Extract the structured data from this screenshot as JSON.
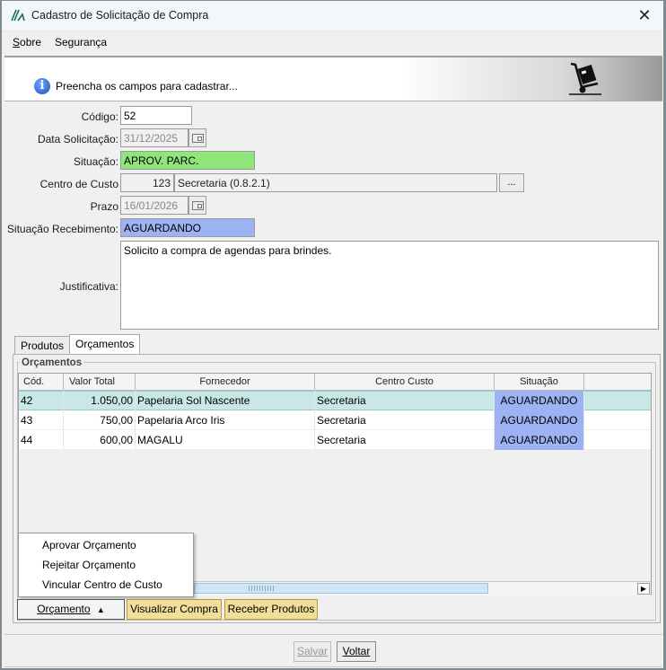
{
  "window": {
    "title": "Cadastro de Solicitação de Compra",
    "close_glyph": "✕"
  },
  "menu": {
    "items": [
      {
        "prefix": "S",
        "rest": "obre"
      },
      {
        "label": "Segurança"
      }
    ]
  },
  "banner": {
    "text": "Preencha os campos para cadastrar...",
    "icon": "info-icon",
    "image": "hand-truck-icon"
  },
  "form": {
    "codigo": {
      "label": "Código:",
      "value": "52"
    },
    "data_solicitacao": {
      "label": "Data Solicitação:",
      "value": "31/12/2025"
    },
    "situacao": {
      "label": "Situação:",
      "value": "APROV. PARC.",
      "color": "#8fe57a"
    },
    "centro_custo": {
      "label": "Centro de Custo",
      "code": "123",
      "name": "Secretaria (0.8.2.1)",
      "button": "..."
    },
    "prazo": {
      "label": "Prazo",
      "value": "16/01/2026"
    },
    "situacao_recebimento": {
      "label": "Situação Recebimento:",
      "value": "AGUARDANDO",
      "color": "#9db2f2"
    },
    "justificativa": {
      "label": "Justificativa:",
      "value": "Solicito a compra de agendas para brindes."
    }
  },
  "tabs": [
    {
      "label": "Produtos",
      "active": false
    },
    {
      "label": "Orçamentos",
      "active": true
    }
  ],
  "orcamentos": {
    "group_title": "Orçamentos",
    "columns": [
      "Cód.",
      "Valor Total",
      "Fornecedor",
      "Centro Custo",
      "Situação"
    ],
    "rows": [
      {
        "cod": "42",
        "valor": "1.050,00",
        "fornecedor": "Papelaria Sol Nascente",
        "centro": "Secretaria",
        "situacao": "AGUARDANDO",
        "selected": true
      },
      {
        "cod": "43",
        "valor": "750,00",
        "fornecedor": "Papelaria Arco Iris",
        "centro": "Secretaria",
        "situacao": "AGUARDANDO",
        "selected": false
      },
      {
        "cod": "44",
        "valor": "600,00",
        "fornecedor": "MAGALU",
        "centro": "Secretaria",
        "situacao": "AGUARDANDO",
        "selected": false
      }
    ],
    "status_color": "#9db2f2",
    "selected_color": "#c8e8e8"
  },
  "popup_menu": {
    "items": [
      "Aprovar Orçamento",
      "Rejeitar Orçamento",
      "Vincular Centro de Custo"
    ]
  },
  "action_buttons": {
    "orcamento": "Orçamento",
    "visualizar": "Visualizar Compra",
    "receber": "Receber Produtos"
  },
  "footer": {
    "salvar": "Salvar",
    "voltar": "Voltar"
  }
}
